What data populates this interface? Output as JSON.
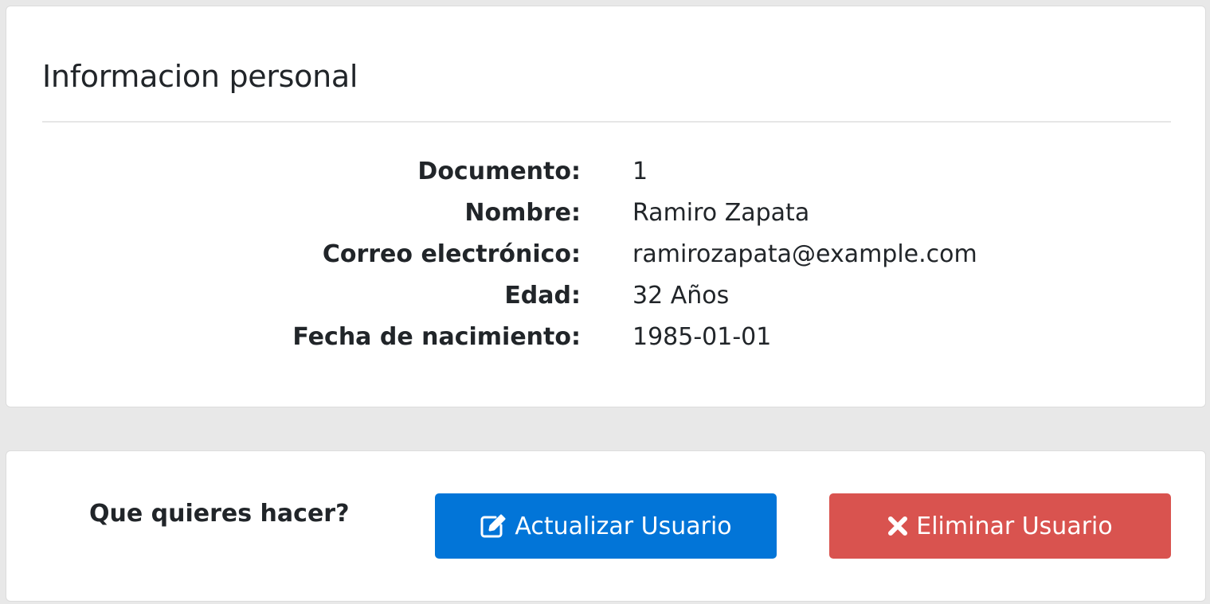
{
  "info": {
    "title": "Informacion personal",
    "fields": [
      {
        "label": "Documento:",
        "value": "1"
      },
      {
        "label": "Nombre:",
        "value": "Ramiro Zapata"
      },
      {
        "label": "Correo electrónico:",
        "value": "ramirozapata@example.com"
      },
      {
        "label": "Edad:",
        "value": "32 Años"
      },
      {
        "label": "Fecha de nacimiento:",
        "value": "1985-01-01"
      }
    ]
  },
  "actions": {
    "question": "Que quieres hacer?",
    "update": {
      "label": "Actualizar Usuario",
      "icon": "edit-icon",
      "color": "#0275d8"
    },
    "delete": {
      "label": "Eliminar Usuario",
      "icon": "close-icon",
      "color": "#d9534f"
    }
  },
  "colors": {
    "background": "#e8e8e8",
    "card": "#ffffff",
    "text": "#212529"
  }
}
